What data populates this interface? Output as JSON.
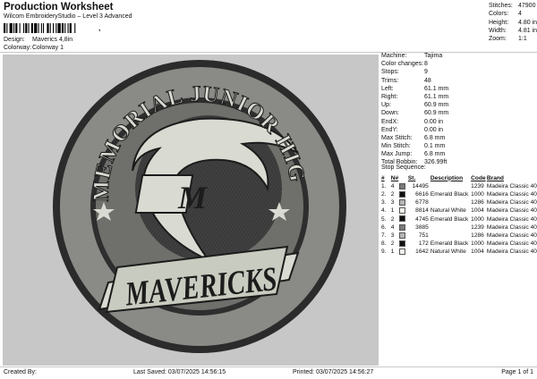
{
  "header": {
    "title": "Production Worksheet",
    "software": "Wilcom EmbroideryStudio – Level 3 Advanced",
    "barcode_suffix": ",",
    "design_label": "Design:",
    "design_value": "Maverics 4,8in",
    "colorway_label": "Colorway:",
    "colorway_value": "Colorway 1"
  },
  "stats": [
    {
      "label": "Stitches:",
      "value": "47900"
    },
    {
      "label": "Colors:",
      "value": "4"
    },
    {
      "label": "Height:",
      "value": "4.80 in"
    },
    {
      "label": "Width:",
      "value": "4.81 in"
    },
    {
      "label": "Zoom:",
      "value": "1:1"
    }
  ],
  "machine": [
    {
      "label": "Machine:",
      "value": "Tajima"
    },
    {
      "label": "Color changes:",
      "value": "8"
    },
    {
      "label": "Stops:",
      "value": "9"
    },
    {
      "label": "Trims:",
      "value": "48"
    },
    {
      "label": "Left:",
      "value": "61.1 mm"
    },
    {
      "label": "Right:",
      "value": "61.1 mm"
    },
    {
      "label": "Up:",
      "value": "60.9 mm"
    },
    {
      "label": "Down:",
      "value": "60.9 mm"
    },
    {
      "label": "EndX:",
      "value": "0.00 in"
    },
    {
      "label": "EndY:",
      "value": "0.00 in"
    },
    {
      "label": "Max Stitch:",
      "value": "6.8 mm"
    },
    {
      "label": "Min Stitch:",
      "value": "0.1 mm"
    },
    {
      "label": "Max Jump:",
      "value": "6.8 mm"
    },
    {
      "label": "Total Bobbin:",
      "value": "326.99ft"
    }
  ],
  "stop_sequence": {
    "title": "Stop Sequence:",
    "headers": {
      "num": "#",
      "n": "N#",
      "st": "St.",
      "desc": "Description",
      "code": "Code",
      "brand": "Brand"
    },
    "rows": [
      {
        "num": "1.",
        "n": "4",
        "color": "#7a7a7a",
        "st": "14495",
        "desc": "",
        "code": "1239",
        "brand": "Madeira Classic 40"
      },
      {
        "num": "2.",
        "n": "2",
        "color": "#111111",
        "st": "6616",
        "desc": "Emerald Black",
        "code": "1000",
        "brand": "Madeira Classic 40"
      },
      {
        "num": "3.",
        "n": "3",
        "color": "#b5b5b5",
        "st": "6778",
        "desc": "",
        "code": "1286",
        "brand": "Madeira Classic 40"
      },
      {
        "num": "4.",
        "n": "1",
        "color": "#f4f4ee",
        "st": "8814",
        "desc": "Natural White",
        "code": "1004",
        "brand": "Madeira Classic 40"
      },
      {
        "num": "5.",
        "n": "2",
        "color": "#111111",
        "st": "4745",
        "desc": "Emerald Black",
        "code": "1000",
        "brand": "Madeira Classic 40"
      },
      {
        "num": "6.",
        "n": "4",
        "color": "#7a7a7a",
        "st": "3885",
        "desc": "",
        "code": "1239",
        "brand": "Madeira Classic 40"
      },
      {
        "num": "7.",
        "n": "3",
        "color": "#b5b5b5",
        "st": "751",
        "desc": "",
        "code": "1286",
        "brand": "Madeira Classic 40"
      },
      {
        "num": "8.",
        "n": "2",
        "color": "#111111",
        "st": "172",
        "desc": "Emerald Black",
        "code": "1000",
        "brand": "Madeira Classic 40"
      },
      {
        "num": "9.",
        "n": "1",
        "color": "#f4f4ee",
        "st": "1642",
        "desc": "Natural White",
        "code": "1004",
        "brand": "Madeira Classic 40"
      }
    ]
  },
  "design_preview": {
    "arc_text": "MEMORIAL JUNIOR HIGH",
    "monogram": "M",
    "banner_text": "MAVERICKS"
  },
  "footer": {
    "created": "Created By:",
    "saved": "Last Saved: 03/07/2025 14:56:15",
    "printed": "Printed: 03/07/2025 14:56:27",
    "page": "Page 1 of 1"
  }
}
